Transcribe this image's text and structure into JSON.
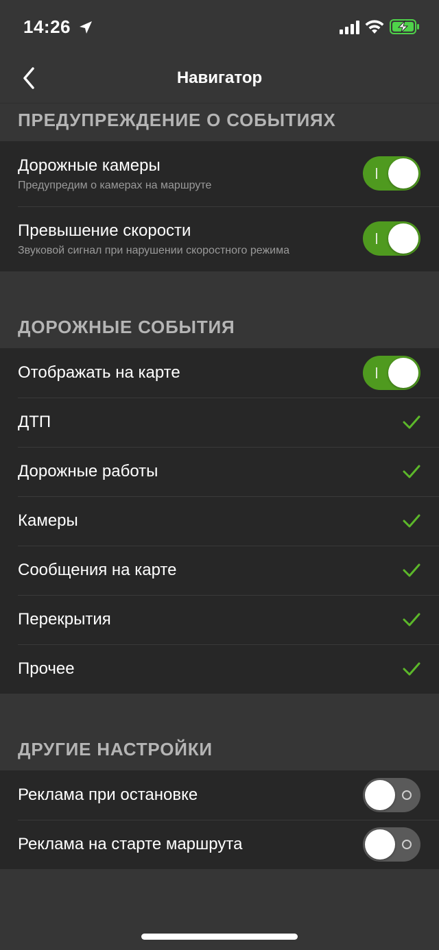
{
  "status_bar": {
    "time": "14:26",
    "icons": [
      "location-arrow-icon",
      "cellular-signal-icon",
      "wifi-icon",
      "battery-charging-icon"
    ],
    "battery_color": "#4fd24a"
  },
  "header": {
    "title": "Навигатор",
    "back_icon": "chevron-left-icon"
  },
  "colors": {
    "accent_green": "#4f9a1f",
    "check_green": "#5cb82a",
    "background": "#363636",
    "group_background": "#272727"
  },
  "sections": {
    "event_warnings": {
      "title": "ПРЕДУПРЕЖДЕНИЕ О СОБЫТИЯХ",
      "items": [
        {
          "title": "Дорожные камеры",
          "subtitle": "Предупредим о камерах на маршруте",
          "toggle": "on"
        },
        {
          "title": "Превышение скорости",
          "subtitle": "Звуковой сигнал при нарушении скоростного режима",
          "toggle": "on"
        }
      ]
    },
    "road_events": {
      "title": "ДОРОЖНЫЕ СОБЫТИЯ",
      "show_on_map": {
        "title": "Отображать на карте",
        "toggle": "on"
      },
      "items": [
        {
          "title": "ДТП",
          "checked": true
        },
        {
          "title": "Дорожные работы",
          "checked": true
        },
        {
          "title": "Камеры",
          "checked": true
        },
        {
          "title": "Сообщения на карте",
          "checked": true
        },
        {
          "title": "Перекрытия",
          "checked": true
        },
        {
          "title": "Прочее",
          "checked": true
        }
      ]
    },
    "other_settings": {
      "title": "ДРУГИЕ НАСТРОЙКИ",
      "items": [
        {
          "title": "Реклама при остановке",
          "toggle": "off"
        },
        {
          "title": "Реклама на старте маршрута",
          "toggle": "off"
        }
      ]
    }
  }
}
